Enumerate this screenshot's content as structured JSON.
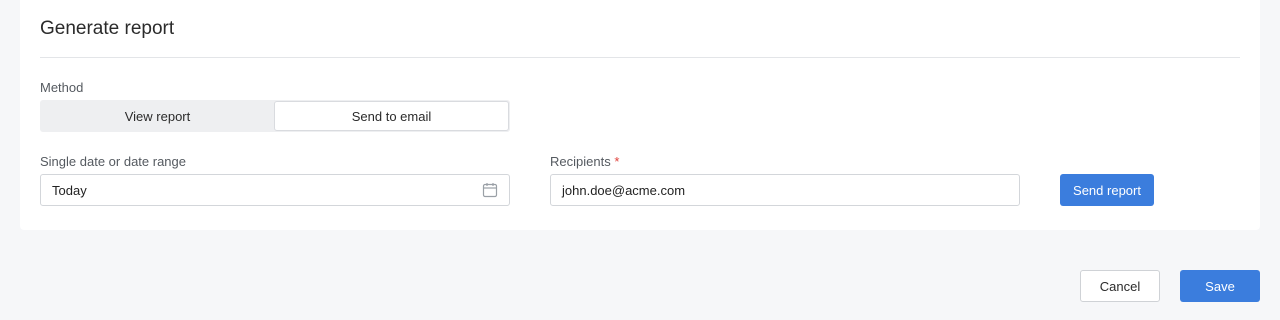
{
  "card": {
    "title": "Generate report"
  },
  "method": {
    "label": "Method",
    "options": [
      "View report",
      "Send to email"
    ],
    "selected": "Send to email"
  },
  "date_field": {
    "label": "Single date or date range",
    "value": "Today",
    "icon": "calendar-icon"
  },
  "recipients_field": {
    "label": "Recipients",
    "required_marker": "*",
    "value": "john.doe@acme.com"
  },
  "actions": {
    "send_report": "Send report",
    "cancel": "Cancel",
    "save": "Save"
  },
  "colors": {
    "primary": "#3b7ddd",
    "required": "#e0423c",
    "background": "#f6f7f9"
  }
}
